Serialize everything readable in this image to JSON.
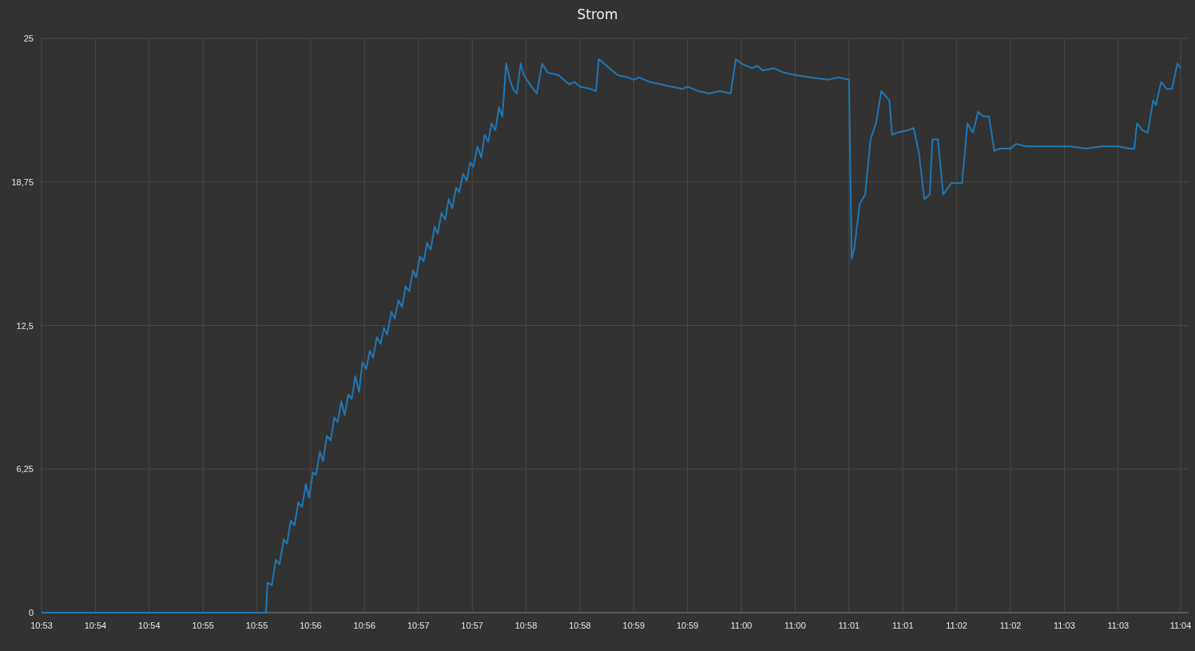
{
  "chart": {
    "chart_data": {
      "type": "line",
      "title": "Strom",
      "grid": true,
      "xlim": [
        653.25,
        663.83
      ],
      "ylim": [
        0,
        25
      ],
      "xticks": [
        {
          "value": 653.25,
          "label": "10:53"
        },
        {
          "value": 653.75,
          "label": "10:54"
        },
        {
          "value": 654.25,
          "label": "10:54"
        },
        {
          "value": 654.75,
          "label": "10:55"
        },
        {
          "value": 655.25,
          "label": "10:55"
        },
        {
          "value": 655.75,
          "label": "10:56"
        },
        {
          "value": 656.25,
          "label": "10:56"
        },
        {
          "value": 656.75,
          "label": "10:57"
        },
        {
          "value": 657.25,
          "label": "10:57"
        },
        {
          "value": 657.75,
          "label": "10:58"
        },
        {
          "value": 658.25,
          "label": "10:58"
        },
        {
          "value": 658.75,
          "label": "10:59"
        },
        {
          "value": 659.25,
          "label": "10:59"
        },
        {
          "value": 659.75,
          "label": "11:00"
        },
        {
          "value": 660.25,
          "label": "11:00"
        },
        {
          "value": 660.75,
          "label": "11:01"
        },
        {
          "value": 661.25,
          "label": "11:01"
        },
        {
          "value": 661.75,
          "label": "11:02"
        },
        {
          "value": 662.25,
          "label": "11:02"
        },
        {
          "value": 662.75,
          "label": "11:03"
        },
        {
          "value": 663.25,
          "label": "11:03"
        },
        {
          "value": 663.83,
          "label": "11:04"
        }
      ],
      "yticks": [
        {
          "value": 0,
          "label": "0"
        },
        {
          "value": 6.25,
          "label": "6,25"
        },
        {
          "value": 12.5,
          "label": "12,5"
        },
        {
          "value": 18.75,
          "label": "18,75"
        },
        {
          "value": 25,
          "label": "25"
        }
      ],
      "x": [
        653.25,
        655.335,
        655.35,
        655.39,
        655.425,
        655.46,
        655.5,
        655.53,
        655.565,
        655.6,
        655.635,
        655.67,
        655.705,
        655.735,
        655.77,
        655.8,
        655.835,
        655.865,
        655.9,
        655.935,
        655.97,
        656.0,
        656.035,
        656.065,
        656.1,
        656.13,
        656.165,
        656.2,
        656.23,
        656.265,
        656.3,
        656.33,
        656.365,
        656.4,
        656.43,
        656.46,
        656.5,
        656.53,
        656.565,
        656.6,
        656.63,
        656.665,
        656.7,
        656.73,
        656.765,
        656.8,
        656.83,
        656.865,
        656.9,
        656.93,
        656.965,
        657.0,
        657.03,
        657.065,
        657.1,
        657.13,
        657.165,
        657.2,
        657.23,
        657.26,
        657.3,
        657.335,
        657.365,
        657.4,
        657.43,
        657.465,
        657.5,
        657.53,
        657.565,
        657.6,
        657.63,
        657.665,
        657.7,
        657.73,
        657.8,
        657.85,
        657.9,
        657.95,
        658.05,
        658.15,
        658.2,
        658.25,
        658.35,
        658.4,
        658.425,
        658.5,
        658.6,
        658.7,
        658.75,
        658.8,
        658.9,
        659.0,
        659.1,
        659.2,
        659.25,
        659.35,
        659.45,
        659.55,
        659.65,
        659.7,
        659.75,
        659.85,
        659.9,
        659.95,
        660.05,
        660.15,
        660.25,
        660.4,
        660.55,
        660.65,
        660.75,
        660.775,
        660.8,
        660.85,
        660.9,
        660.95,
        661.0,
        661.05,
        661.125,
        661.15,
        661.2,
        661.3,
        661.35,
        661.4,
        661.45,
        661.5,
        661.525,
        661.575,
        661.625,
        661.7,
        661.8,
        661.85,
        661.9,
        661.95,
        662.0,
        662.05,
        662.1,
        662.15,
        662.25,
        662.3,
        662.4,
        662.5,
        662.65,
        662.8,
        662.95,
        663.1,
        663.25,
        663.35,
        663.4,
        663.425,
        663.475,
        663.525,
        663.575,
        663.6,
        663.65,
        663.7,
        663.75,
        663.8,
        663.83
      ],
      "series": [
        {
          "color": "#1f77b4",
          "values": [
            0,
            0,
            1.3,
            1.2,
            2.3,
            2.1,
            3.2,
            3.0,
            4.0,
            3.8,
            4.8,
            4.6,
            5.6,
            5.0,
            6.1,
            6.0,
            7.0,
            6.6,
            7.7,
            7.5,
            8.5,
            8.3,
            9.2,
            8.6,
            9.5,
            9.3,
            10.3,
            9.6,
            10.9,
            10.6,
            11.4,
            11.1,
            12.0,
            11.7,
            12.4,
            12.1,
            13.1,
            12.8,
            13.6,
            13.3,
            14.2,
            14.0,
            14.9,
            14.6,
            15.5,
            15.3,
            16.1,
            15.8,
            16.8,
            16.5,
            17.4,
            17.1,
            18.0,
            17.6,
            18.5,
            18.3,
            19.1,
            18.8,
            19.6,
            19.4,
            20.3,
            19.8,
            20.8,
            20.5,
            21.3,
            21.0,
            22.0,
            21.6,
            23.9,
            23.2,
            22.8,
            22.6,
            23.9,
            23.4,
            22.9,
            22.6,
            23.9,
            23.5,
            23.4,
            23.0,
            23.1,
            22.9,
            22.8,
            22.7,
            24.1,
            23.8,
            23.4,
            23.3,
            23.2,
            23.3,
            23.1,
            23.0,
            22.9,
            22.8,
            22.9,
            22.7,
            22.6,
            22.7,
            22.6,
            24.1,
            23.9,
            23.7,
            23.8,
            23.6,
            23.7,
            23.5,
            23.4,
            23.3,
            23.2,
            23.3,
            23.2,
            15.4,
            15.9,
            17.8,
            18.2,
            20.6,
            21.3,
            22.7,
            22.3,
            20.8,
            20.9,
            21.0,
            21.1,
            20.0,
            18.0,
            18.2,
            20.6,
            20.6,
            18.2,
            18.7,
            18.7,
            21.3,
            20.9,
            21.8,
            21.6,
            21.6,
            20.1,
            20.2,
            20.2,
            20.4,
            20.3,
            20.3,
            20.3,
            20.3,
            20.2,
            20.3,
            20.3,
            20.2,
            20.2,
            21.3,
            21.0,
            20.9,
            22.3,
            22.1,
            23.1,
            22.8,
            22.8,
            23.9,
            23.7
          ]
        }
      ]
    }
  }
}
